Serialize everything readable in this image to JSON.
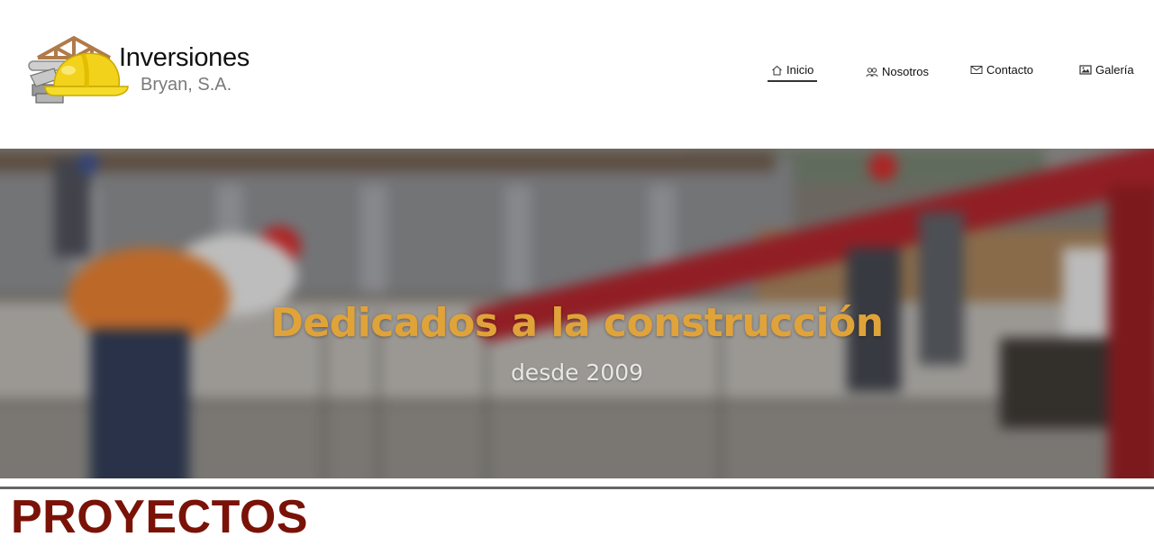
{
  "brand": {
    "name_line1": "Inversiones",
    "name_line2": "Bryan, S.A."
  },
  "nav": {
    "items": [
      {
        "label": "Inicio",
        "icon": "home-icon",
        "active": true
      },
      {
        "label": "Nosotros",
        "icon": "users-icon",
        "active": false
      },
      {
        "label": "Contacto",
        "icon": "envelope-icon",
        "active": false
      },
      {
        "label": "Galería",
        "icon": "picture-icon",
        "active": false
      }
    ]
  },
  "hero": {
    "title": "Dedicados a la construcción",
    "subtitle": "desde 2009"
  },
  "section": {
    "title": "PROYECTOS"
  },
  "colors": {
    "hero_title": "#e0a33a",
    "section_title": "#7a1208",
    "helmet_yellow": "#f2d21b"
  }
}
